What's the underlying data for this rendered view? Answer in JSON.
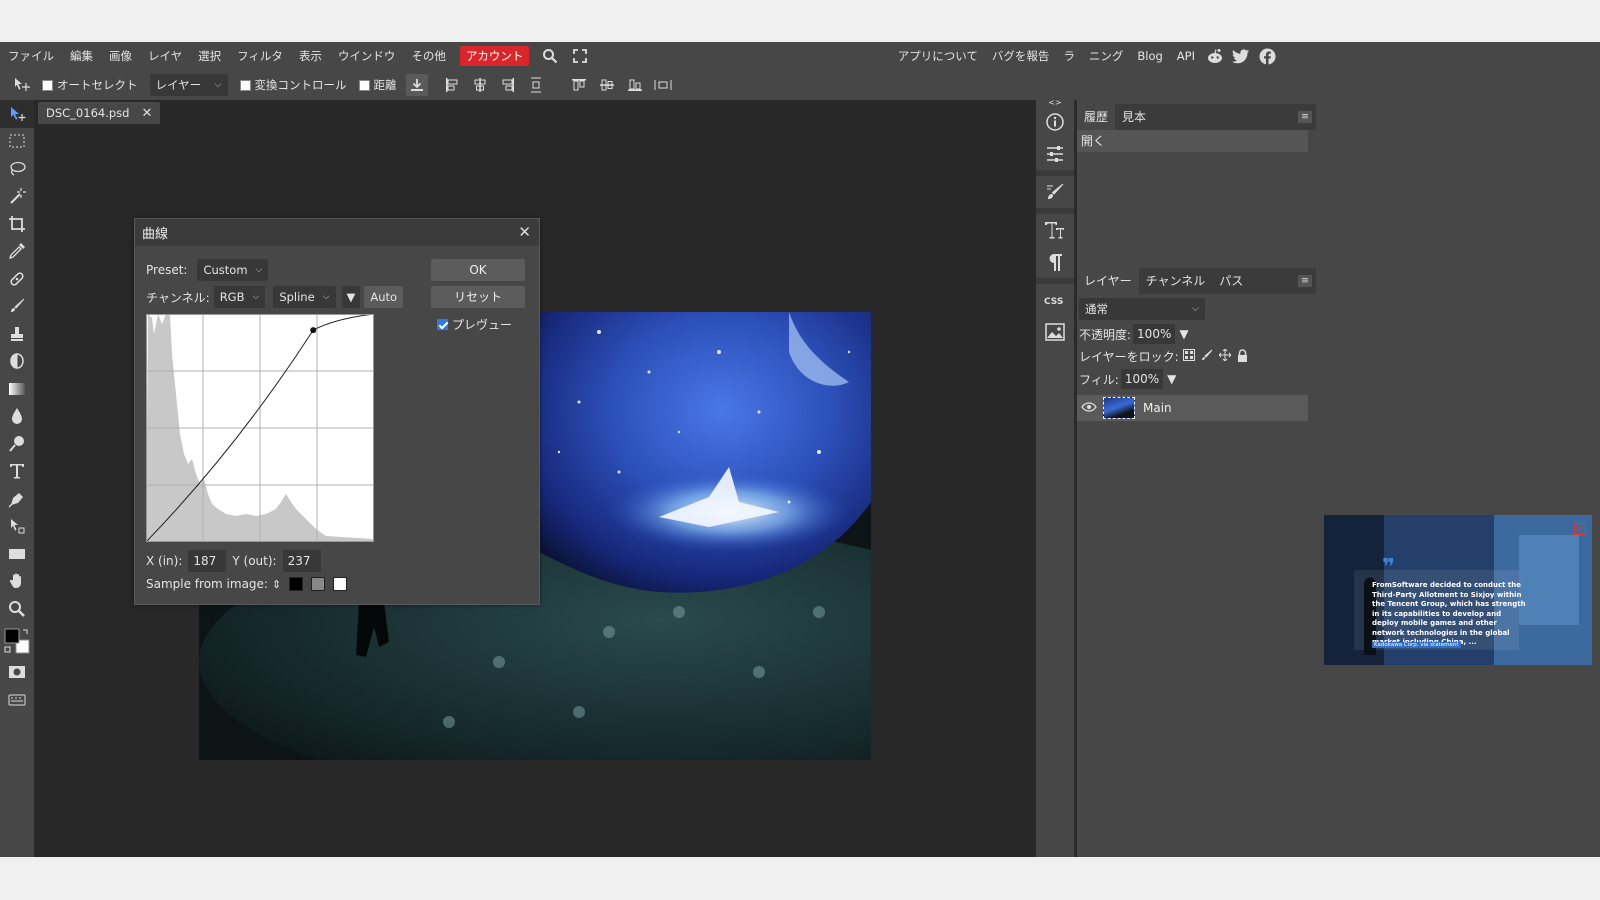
{
  "menubar": {
    "items": [
      "ファイル",
      "編集",
      "画像",
      "レイヤ",
      "選択",
      "フィルタ",
      "表示",
      "ウインドウ",
      "その他"
    ],
    "account": "アカウント",
    "right_links": [
      "アプリについて",
      "バグを報告",
      "ラ",
      "ニング",
      "Blog",
      "API"
    ],
    "social_icons": [
      "reddit-icon",
      "twitter-icon",
      "facebook-icon"
    ]
  },
  "options": {
    "auto_select": "オートセレクト",
    "layer_select": "レイヤー",
    "transform_controls": "変換コントロール",
    "distance": "距離"
  },
  "document": {
    "tab": "DSC_0164.psd"
  },
  "curves": {
    "title": "曲線",
    "preset_label": "Preset:",
    "preset_value": "Custom",
    "channel_label": "チャンネル:",
    "channel_value": "RGB",
    "interp_value": "Spline",
    "auto": "Auto",
    "ok": "OK",
    "reset": "リセット",
    "preview": "プレヴュー",
    "x_label": "X (in):",
    "x_value": "187",
    "y_label": "Y (out):",
    "y_value": "237",
    "sample_label": "Sample from image:",
    "sample_marker": "⇕",
    "curve_points": [
      [
        0,
        0
      ],
      [
        187,
        237
      ],
      [
        255,
        255
      ]
    ]
  },
  "history": {
    "tabs": [
      "履歴",
      "見本"
    ],
    "items": [
      "開く"
    ]
  },
  "layers": {
    "tabs": [
      "レイヤー",
      "チャンネル",
      "パス"
    ],
    "blend_mode": "通常",
    "opacity_label": "不透明度:",
    "opacity_value": "100%",
    "lock_label": "レイヤーをロック:",
    "fill_label": "フィル:",
    "fill_value": "100%",
    "layer_name": "Main"
  },
  "ad": {
    "quote": "FromSoftware decided to conduct the Third-Party Allotment to Sixjoy within the Tencent Group, which has strength in its capabilities to develop and deploy mobile games and other network technologies in the global market including China, ...",
    "source": "Kadokawa Corp. via statement"
  },
  "colors": {
    "account_bg": "#d9262b",
    "panel_bg": "#474747",
    "workspace_bg": "#282828",
    "accent_blue": "#2f7bd9"
  }
}
